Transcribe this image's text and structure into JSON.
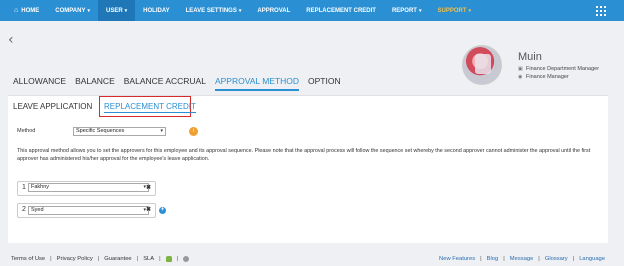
{
  "nav": {
    "home": "HOME",
    "company": "COMPANY",
    "user": "USER",
    "holiday": "HOLIDAY",
    "leave_settings": "LEAVE SETTINGS",
    "approval": "APPROVAL",
    "replacement_credit": "REPLACEMENT CREDIT",
    "report": "REPORT",
    "support": "SUPPORT",
    "caret": "▾",
    "accent": "#2a8fd3",
    "support_color": "#f2c14a"
  },
  "back_icon": "‹",
  "profile": {
    "name": "Muin",
    "department": "Finance Department Manager",
    "role": "Finance Manager"
  },
  "main_tabs": [
    "ALLOWANCE",
    "BALANCE",
    "BALANCE ACCRUAL",
    "APPROVAL METHOD",
    "OPTION"
  ],
  "sub_tabs": {
    "leave_application": "LEAVE APPLICATION",
    "replacement_credit": "REPLACEMENT CREDIT",
    "highlight_color": "#d62b2b"
  },
  "form": {
    "method_label": "Method",
    "method_value": "Specific Sequences",
    "info_icon": "info-icon",
    "description": "This approval method allows you to set the approvers for this employee and its approval sequence. Please note that the approval process will follow the sequence set whereby the second approver cannot administer the approval until the first approver has administered his/her approval for the employee's leave application.",
    "approvers": [
      {
        "number": "1",
        "value": "Fakhny"
      },
      {
        "number": "2",
        "value": "Syed"
      }
    ],
    "remove_symbol": "✖",
    "add_symbol": "+"
  },
  "footer": {
    "left": [
      "Terms of Use",
      "Privacy Policy",
      "Guarantee",
      "SLA"
    ],
    "right": [
      "New Features",
      "Blog",
      "Message",
      "Glossary",
      "Language"
    ],
    "separator": "|"
  }
}
